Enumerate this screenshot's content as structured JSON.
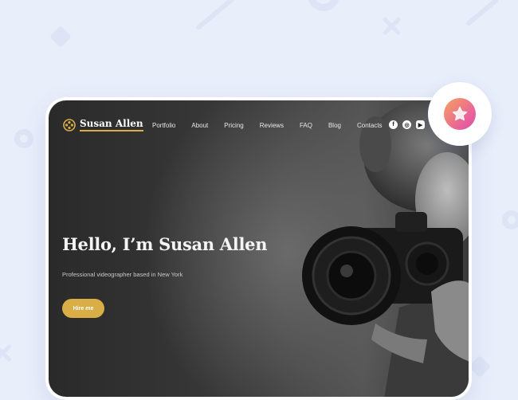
{
  "brand": {
    "name": "Susan Allen",
    "logo_icon": "film-reel-icon"
  },
  "nav": {
    "items": [
      "Portfolio",
      "About",
      "Pricing",
      "Reviews",
      "FAQ",
      "Blog",
      "Contacts"
    ]
  },
  "social": {
    "facebook": "f",
    "instagram": "◎",
    "youtube": "▶"
  },
  "hero": {
    "title": "Hello, I’m Susan Allen",
    "subtitle": "Professional videographer based in New York",
    "cta_label": "Hire me"
  },
  "badge": {
    "icon": "star-icon"
  },
  "colors": {
    "accent": "#d9ae47",
    "background": "#e9eefb"
  }
}
